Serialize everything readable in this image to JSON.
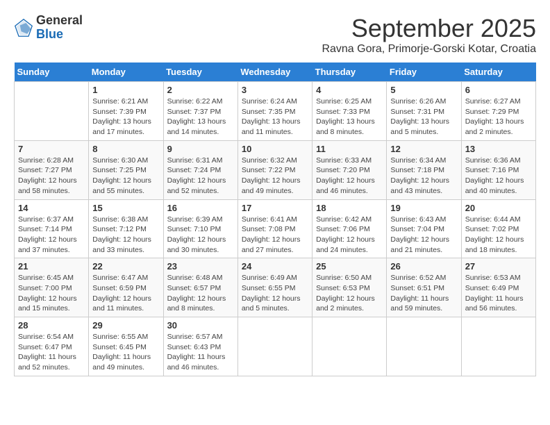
{
  "header": {
    "logo_general": "General",
    "logo_blue": "Blue",
    "month_title": "September 2025",
    "location": "Ravna Gora, Primorje-Gorski Kotar, Croatia"
  },
  "weekdays": [
    "Sunday",
    "Monday",
    "Tuesday",
    "Wednesday",
    "Thursday",
    "Friday",
    "Saturday"
  ],
  "weeks": [
    [
      {
        "day": "",
        "sunrise": "",
        "sunset": "",
        "daylight": ""
      },
      {
        "day": "1",
        "sunrise": "Sunrise: 6:21 AM",
        "sunset": "Sunset: 7:39 PM",
        "daylight": "Daylight: 13 hours and 17 minutes."
      },
      {
        "day": "2",
        "sunrise": "Sunrise: 6:22 AM",
        "sunset": "Sunset: 7:37 PM",
        "daylight": "Daylight: 13 hours and 14 minutes."
      },
      {
        "day": "3",
        "sunrise": "Sunrise: 6:24 AM",
        "sunset": "Sunset: 7:35 PM",
        "daylight": "Daylight: 13 hours and 11 minutes."
      },
      {
        "day": "4",
        "sunrise": "Sunrise: 6:25 AM",
        "sunset": "Sunset: 7:33 PM",
        "daylight": "Daylight: 13 hours and 8 minutes."
      },
      {
        "day": "5",
        "sunrise": "Sunrise: 6:26 AM",
        "sunset": "Sunset: 7:31 PM",
        "daylight": "Daylight: 13 hours and 5 minutes."
      },
      {
        "day": "6",
        "sunrise": "Sunrise: 6:27 AM",
        "sunset": "Sunset: 7:29 PM",
        "daylight": "Daylight: 13 hours and 2 minutes."
      }
    ],
    [
      {
        "day": "7",
        "sunrise": "Sunrise: 6:28 AM",
        "sunset": "Sunset: 7:27 PM",
        "daylight": "Daylight: 12 hours and 58 minutes."
      },
      {
        "day": "8",
        "sunrise": "Sunrise: 6:30 AM",
        "sunset": "Sunset: 7:25 PM",
        "daylight": "Daylight: 12 hours and 55 minutes."
      },
      {
        "day": "9",
        "sunrise": "Sunrise: 6:31 AM",
        "sunset": "Sunset: 7:24 PM",
        "daylight": "Daylight: 12 hours and 52 minutes."
      },
      {
        "day": "10",
        "sunrise": "Sunrise: 6:32 AM",
        "sunset": "Sunset: 7:22 PM",
        "daylight": "Daylight: 12 hours and 49 minutes."
      },
      {
        "day": "11",
        "sunrise": "Sunrise: 6:33 AM",
        "sunset": "Sunset: 7:20 PM",
        "daylight": "Daylight: 12 hours and 46 minutes."
      },
      {
        "day": "12",
        "sunrise": "Sunrise: 6:34 AM",
        "sunset": "Sunset: 7:18 PM",
        "daylight": "Daylight: 12 hours and 43 minutes."
      },
      {
        "day": "13",
        "sunrise": "Sunrise: 6:36 AM",
        "sunset": "Sunset: 7:16 PM",
        "daylight": "Daylight: 12 hours and 40 minutes."
      }
    ],
    [
      {
        "day": "14",
        "sunrise": "Sunrise: 6:37 AM",
        "sunset": "Sunset: 7:14 PM",
        "daylight": "Daylight: 12 hours and 37 minutes."
      },
      {
        "day": "15",
        "sunrise": "Sunrise: 6:38 AM",
        "sunset": "Sunset: 7:12 PM",
        "daylight": "Daylight: 12 hours and 33 minutes."
      },
      {
        "day": "16",
        "sunrise": "Sunrise: 6:39 AM",
        "sunset": "Sunset: 7:10 PM",
        "daylight": "Daylight: 12 hours and 30 minutes."
      },
      {
        "day": "17",
        "sunrise": "Sunrise: 6:41 AM",
        "sunset": "Sunset: 7:08 PM",
        "daylight": "Daylight: 12 hours and 27 minutes."
      },
      {
        "day": "18",
        "sunrise": "Sunrise: 6:42 AM",
        "sunset": "Sunset: 7:06 PM",
        "daylight": "Daylight: 12 hours and 24 minutes."
      },
      {
        "day": "19",
        "sunrise": "Sunrise: 6:43 AM",
        "sunset": "Sunset: 7:04 PM",
        "daylight": "Daylight: 12 hours and 21 minutes."
      },
      {
        "day": "20",
        "sunrise": "Sunrise: 6:44 AM",
        "sunset": "Sunset: 7:02 PM",
        "daylight": "Daylight: 12 hours and 18 minutes."
      }
    ],
    [
      {
        "day": "21",
        "sunrise": "Sunrise: 6:45 AM",
        "sunset": "Sunset: 7:00 PM",
        "daylight": "Daylight: 12 hours and 15 minutes."
      },
      {
        "day": "22",
        "sunrise": "Sunrise: 6:47 AM",
        "sunset": "Sunset: 6:59 PM",
        "daylight": "Daylight: 12 hours and 11 minutes."
      },
      {
        "day": "23",
        "sunrise": "Sunrise: 6:48 AM",
        "sunset": "Sunset: 6:57 PM",
        "daylight": "Daylight: 12 hours and 8 minutes."
      },
      {
        "day": "24",
        "sunrise": "Sunrise: 6:49 AM",
        "sunset": "Sunset: 6:55 PM",
        "daylight": "Daylight: 12 hours and 5 minutes."
      },
      {
        "day": "25",
        "sunrise": "Sunrise: 6:50 AM",
        "sunset": "Sunset: 6:53 PM",
        "daylight": "Daylight: 12 hours and 2 minutes."
      },
      {
        "day": "26",
        "sunrise": "Sunrise: 6:52 AM",
        "sunset": "Sunset: 6:51 PM",
        "daylight": "Daylight: 11 hours and 59 minutes."
      },
      {
        "day": "27",
        "sunrise": "Sunrise: 6:53 AM",
        "sunset": "Sunset: 6:49 PM",
        "daylight": "Daylight: 11 hours and 56 minutes."
      }
    ],
    [
      {
        "day": "28",
        "sunrise": "Sunrise: 6:54 AM",
        "sunset": "Sunset: 6:47 PM",
        "daylight": "Daylight: 11 hours and 52 minutes."
      },
      {
        "day": "29",
        "sunrise": "Sunrise: 6:55 AM",
        "sunset": "Sunset: 6:45 PM",
        "daylight": "Daylight: 11 hours and 49 minutes."
      },
      {
        "day": "30",
        "sunrise": "Sunrise: 6:57 AM",
        "sunset": "Sunset: 6:43 PM",
        "daylight": "Daylight: 11 hours and 46 minutes."
      },
      {
        "day": "",
        "sunrise": "",
        "sunset": "",
        "daylight": ""
      },
      {
        "day": "",
        "sunrise": "",
        "sunset": "",
        "daylight": ""
      },
      {
        "day": "",
        "sunrise": "",
        "sunset": "",
        "daylight": ""
      },
      {
        "day": "",
        "sunrise": "",
        "sunset": "",
        "daylight": ""
      }
    ]
  ]
}
